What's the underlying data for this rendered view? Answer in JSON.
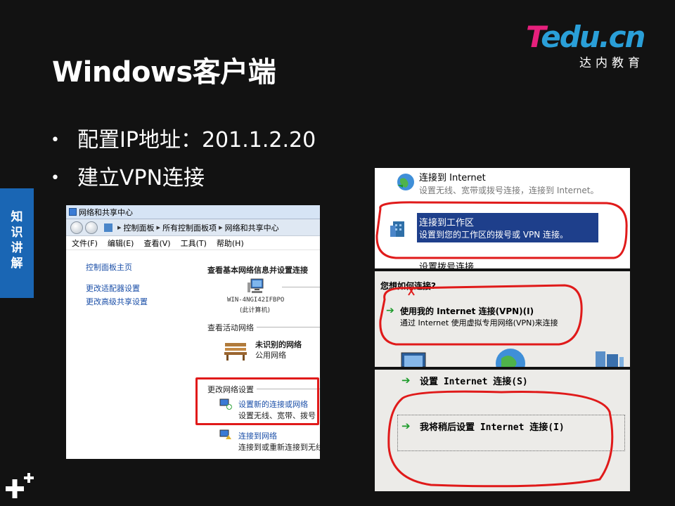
{
  "slide": {
    "title": "Windows客户端",
    "logo_main_t": "T",
    "logo_main_rest": "edu.cn",
    "logo_sub": "达内教育",
    "side_tab": [
      "知",
      "识",
      "讲",
      "解"
    ],
    "bullets": [
      "配置IP地址：201.1.2.20",
      "建立VPN连接"
    ],
    "colors": {
      "logo_pink": "#e6207c",
      "logo_blue": "#2a9fd8",
      "side_tab": "#1a66b4",
      "annotation_red": "#e01a1a"
    }
  },
  "network_center": {
    "window_title": "网络和共享中心",
    "breadcrumb": [
      "控制面板",
      "所有控制面板项",
      "网络和共享中心"
    ],
    "menu": [
      "文件(F)",
      "编辑(E)",
      "查看(V)",
      "工具(T)",
      "帮助(H)"
    ],
    "left_links": [
      "控制面板主页",
      "更改适配器设置",
      "更改高级共享设置"
    ],
    "header": "查看基本网络信息并设置连接",
    "computer_name": "WIN-4NGI42IFBPO",
    "computer_caption": "(此计算机)",
    "active_networks": "查看活动网络",
    "network_name": "未识别的网络",
    "network_type": "公用网络",
    "change_settings": "更改网络设置",
    "setup_new_link": "设置新的连接或网络",
    "setup_new_desc": "设置无线、宽带、拨号",
    "connect_link": "连接到网络",
    "connect_desc": "连接到或重新连接到无线"
  },
  "connection_wizard": {
    "option1_title": "连接到 Internet",
    "option1_desc": "设置无线、宽带或拨号连接，连接到 Internet。",
    "option2_title": "连接到工作区",
    "option2_desc": "设置到您的工作区的拨号或 VPN 连接。",
    "option3_title": "设置拨号连接"
  },
  "how_connect": {
    "question": "您想如何连接?",
    "option_title": "使用我的 Internet 连接(VPN)(I)",
    "option_desc": "通过 Internet 使用虚拟专用网络(VPN)来连接"
  },
  "internet_setup": {
    "option1": "设置 Internet 连接(S)",
    "option2": "我将稍后设置 Internet 连接(I)"
  }
}
